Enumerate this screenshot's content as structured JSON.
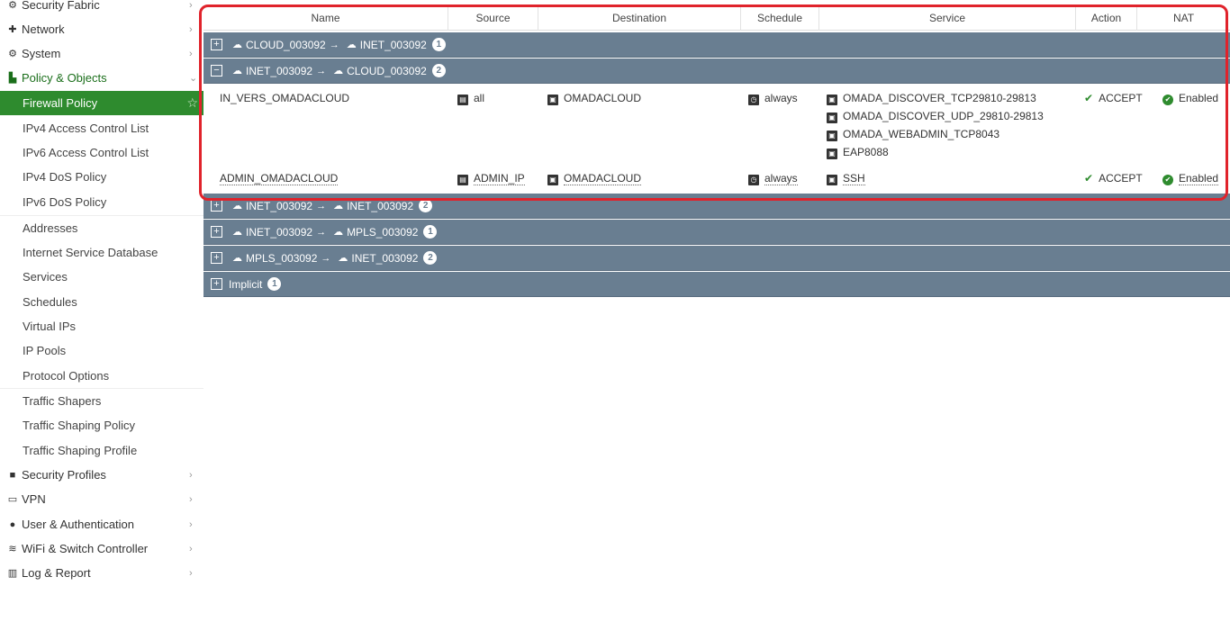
{
  "sidebar": {
    "top_items": [
      {
        "icon": "security-fabric-icon",
        "glyph": "⚙",
        "label": "Security Fabric"
      },
      {
        "icon": "network-icon",
        "glyph": "✚",
        "label": "Network"
      },
      {
        "icon": "system-icon",
        "glyph": "⚙",
        "label": "System"
      },
      {
        "icon": "policy-objects-icon",
        "glyph": "▙",
        "label": "Policy & Objects"
      }
    ],
    "sub_items": [
      "Firewall Policy",
      "IPv4 Access Control List",
      "IPv6 Access Control List",
      "IPv4 DoS Policy",
      "IPv6 DoS Policy",
      "Addresses",
      "Internet Service Database",
      "Services",
      "Schedules",
      "Virtual IPs",
      "IP Pools",
      "Protocol Options",
      "Traffic Shapers",
      "Traffic Shaping Policy",
      "Traffic Shaping Profile"
    ],
    "bottom_items": [
      {
        "icon": "lock-icon",
        "glyph": "🔒",
        "label": "Security Profiles"
      },
      {
        "icon": "vpn-icon",
        "glyph": "▭",
        "label": "VPN"
      },
      {
        "icon": "user-icon",
        "glyph": "👤",
        "label": "User & Authentication"
      },
      {
        "icon": "wifi-icon",
        "glyph": "≋",
        "label": "WiFi & Switch Controller"
      },
      {
        "icon": "log-report-icon",
        "glyph": "▥",
        "label": "Log & Report"
      }
    ]
  },
  "table": {
    "columns": [
      "Name",
      "Source",
      "Destination",
      "Schedule",
      "Service",
      "Action",
      "NAT"
    ],
    "sequences": [
      {
        "toggle": "+",
        "from": "CLOUD_003092",
        "to": "INET_003092",
        "count": "1"
      },
      {
        "toggle": "−",
        "from": "INET_003092",
        "to": "CLOUD_003092",
        "count": "2"
      },
      {
        "toggle": "+",
        "from": "INET_003092",
        "to": "INET_003092",
        "count": "2"
      },
      {
        "toggle": "+",
        "from": "INET_003092",
        "to": "MPLS_003092",
        "count": "1"
      },
      {
        "toggle": "+",
        "from": "MPLS_003092",
        "to": "INET_003092",
        "count": "2"
      }
    ],
    "implicit": {
      "label": "Implicit",
      "count": "1"
    },
    "policies": [
      {
        "name": "IN_VERS_OMADACLOUD",
        "source": "all",
        "destination": "OMADACLOUD",
        "schedule": "always",
        "services": [
          "OMADA_DISCOVER_TCP29810-29813",
          "OMADA_DISCOVER_UDP_29810-29813",
          "OMADA_WEBADMIN_TCP8043",
          "EAP8088"
        ],
        "action": "ACCEPT",
        "nat": "Enabled"
      },
      {
        "name": "ADMIN_OMADACLOUD",
        "source": "ADMIN_IP",
        "destination": "OMADACLOUD",
        "schedule": "always",
        "services": [
          "SSH"
        ],
        "action": "ACCEPT",
        "nat": "Enabled"
      }
    ]
  }
}
